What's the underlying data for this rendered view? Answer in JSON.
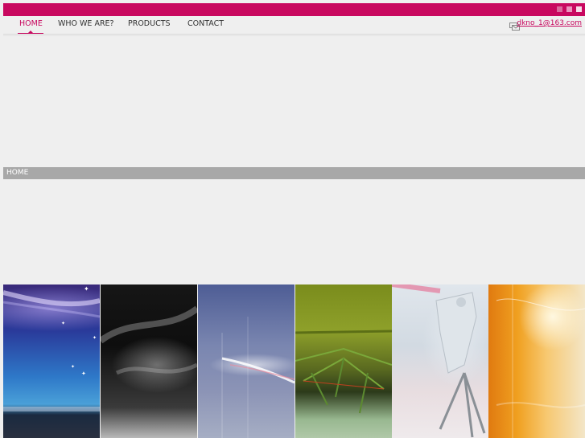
{
  "nav": {
    "items": [
      "HOME",
      "WHO WE ARE?",
      "PRODUCTS",
      "CONTACT"
    ],
    "active": "HOME"
  },
  "contact": {
    "email": "dkno_1@163.com",
    "icon": "mail-icon"
  },
  "section": {
    "label": "HOME"
  },
  "colors": {
    "brand": "#c8085f",
    "section_bar": "#a8a8a8",
    "background": "#efefef"
  },
  "window_controls": [
    "minimize-square",
    "restore-square",
    "close-square"
  ],
  "gallery": [
    "aurora-sky",
    "dark-abstract",
    "blue-streak",
    "green-structure",
    "white-sculpture",
    "orange-glow"
  ]
}
